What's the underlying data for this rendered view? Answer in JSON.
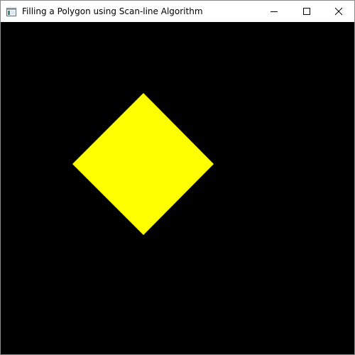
{
  "window": {
    "title": "Filling a Polygon using Scan-line Algorithm",
    "icons": {
      "app": "app-window-icon",
      "minimize": "minimize-icon",
      "maximize": "maximize-icon",
      "close": "close-icon"
    }
  },
  "canvas": {
    "background_color": "#000000",
    "polygon": {
      "shape": "diamond",
      "fill_color": "#ffff00"
    }
  }
}
